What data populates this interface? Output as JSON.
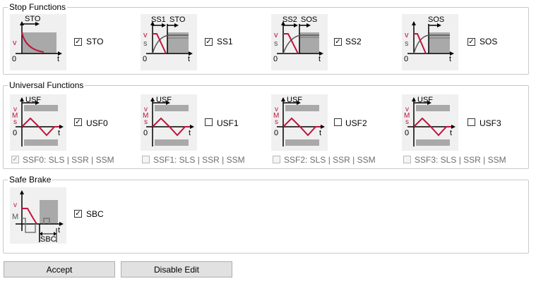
{
  "groups": {
    "stop": {
      "legend": "Stop Functions",
      "items": [
        {
          "label": "STO",
          "checked": true,
          "diagram": "sto-diagram"
        },
        {
          "label": "SS1",
          "checked": true,
          "diagram": "ss1-diagram"
        },
        {
          "label": "SS2",
          "checked": true,
          "diagram": "ss2-diagram"
        },
        {
          "label": "SOS",
          "checked": true,
          "diagram": "sos-diagram"
        }
      ]
    },
    "universal": {
      "legend": "Universal Functions",
      "items": [
        {
          "label": "USF0",
          "checked": true,
          "ssf_label": "SSF0: SLS | SSR | SSM",
          "ssf_checked": true
        },
        {
          "label": "USF1",
          "checked": false,
          "ssf_label": "SSF1: SLS | SSR | SSM",
          "ssf_checked": false
        },
        {
          "label": "USF2",
          "checked": false,
          "ssf_label": "SSF2: SLS | SSR | SSM",
          "ssf_checked": false
        },
        {
          "label": "USF3",
          "checked": false,
          "ssf_label": "SSF3: SLS | SSR | SSM",
          "ssf_checked": false
        }
      ]
    },
    "brake": {
      "legend": "Safe Brake",
      "items": [
        {
          "label": "SBC",
          "checked": true
        }
      ]
    }
  },
  "diagram_text": {
    "sto": {
      "top": "STO",
      "y": "v",
      "origin": "0",
      "x": "t"
    },
    "ss1": {
      "top1": "SS1",
      "top2": "STO",
      "y1": "v",
      "y2": "s",
      "origin": "0",
      "x": "t"
    },
    "ss2": {
      "top1": "SS2",
      "top2": "SOS",
      "y1": "v",
      "y2": "s",
      "origin": "0",
      "x": "t"
    },
    "sos": {
      "top": "SOS",
      "y1": "v",
      "y2": "s",
      "origin": "0",
      "x": "t"
    },
    "usf": {
      "top": "USF",
      "y1": "v",
      "y2": "M",
      "y3": "s",
      "origin": "0",
      "x": "t"
    },
    "sbc": {
      "y1": "v",
      "y2": "M",
      "x": "t",
      "bottom": "SBC"
    }
  },
  "buttons": {
    "accept": "Accept",
    "disable_edit": "Disable Edit"
  },
  "colors": {
    "curve_red": "#c0143c",
    "band_gray": "#a9a9a9",
    "diagram_bg": "#f0f0f0",
    "button_bg": "#e1e1e1"
  }
}
